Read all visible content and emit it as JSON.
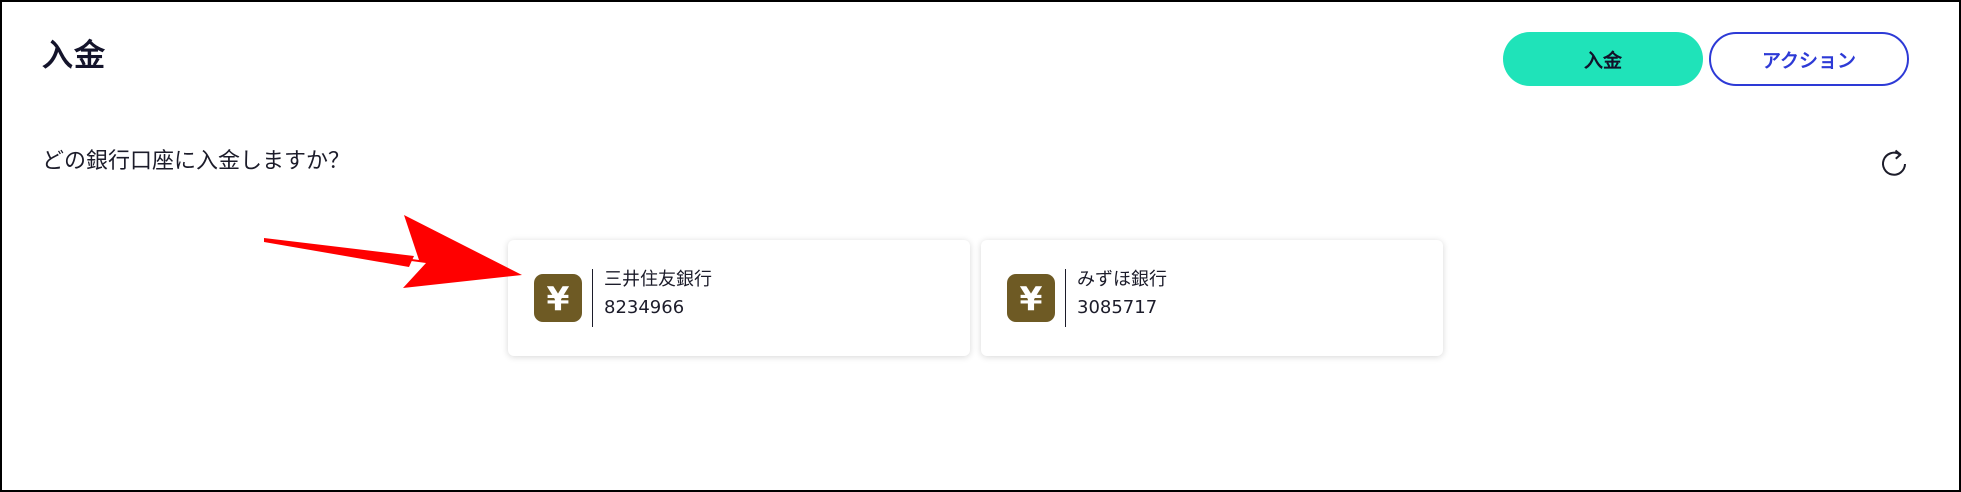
{
  "header": {
    "title": "入金",
    "deposit_button": "入金",
    "action_button": "アクション"
  },
  "question": "どの銀行口座に入金しますか？",
  "icons": {
    "refresh": "refresh-icon",
    "yen": "yen-icon",
    "yen_glyph": "¥",
    "annotation": "red-arrow-annotation"
  },
  "accounts": [
    {
      "bank": "三井住友銀行",
      "number": "8234966"
    },
    {
      "bank": "みずほ銀行",
      "number": "3085717"
    }
  ],
  "colors": {
    "deposit_button_bg": "#1fe3b9",
    "action_button_border": "#2d3ad6",
    "yen_badge_bg": "#6e5a24",
    "annotation_arrow": "#ff0000"
  }
}
